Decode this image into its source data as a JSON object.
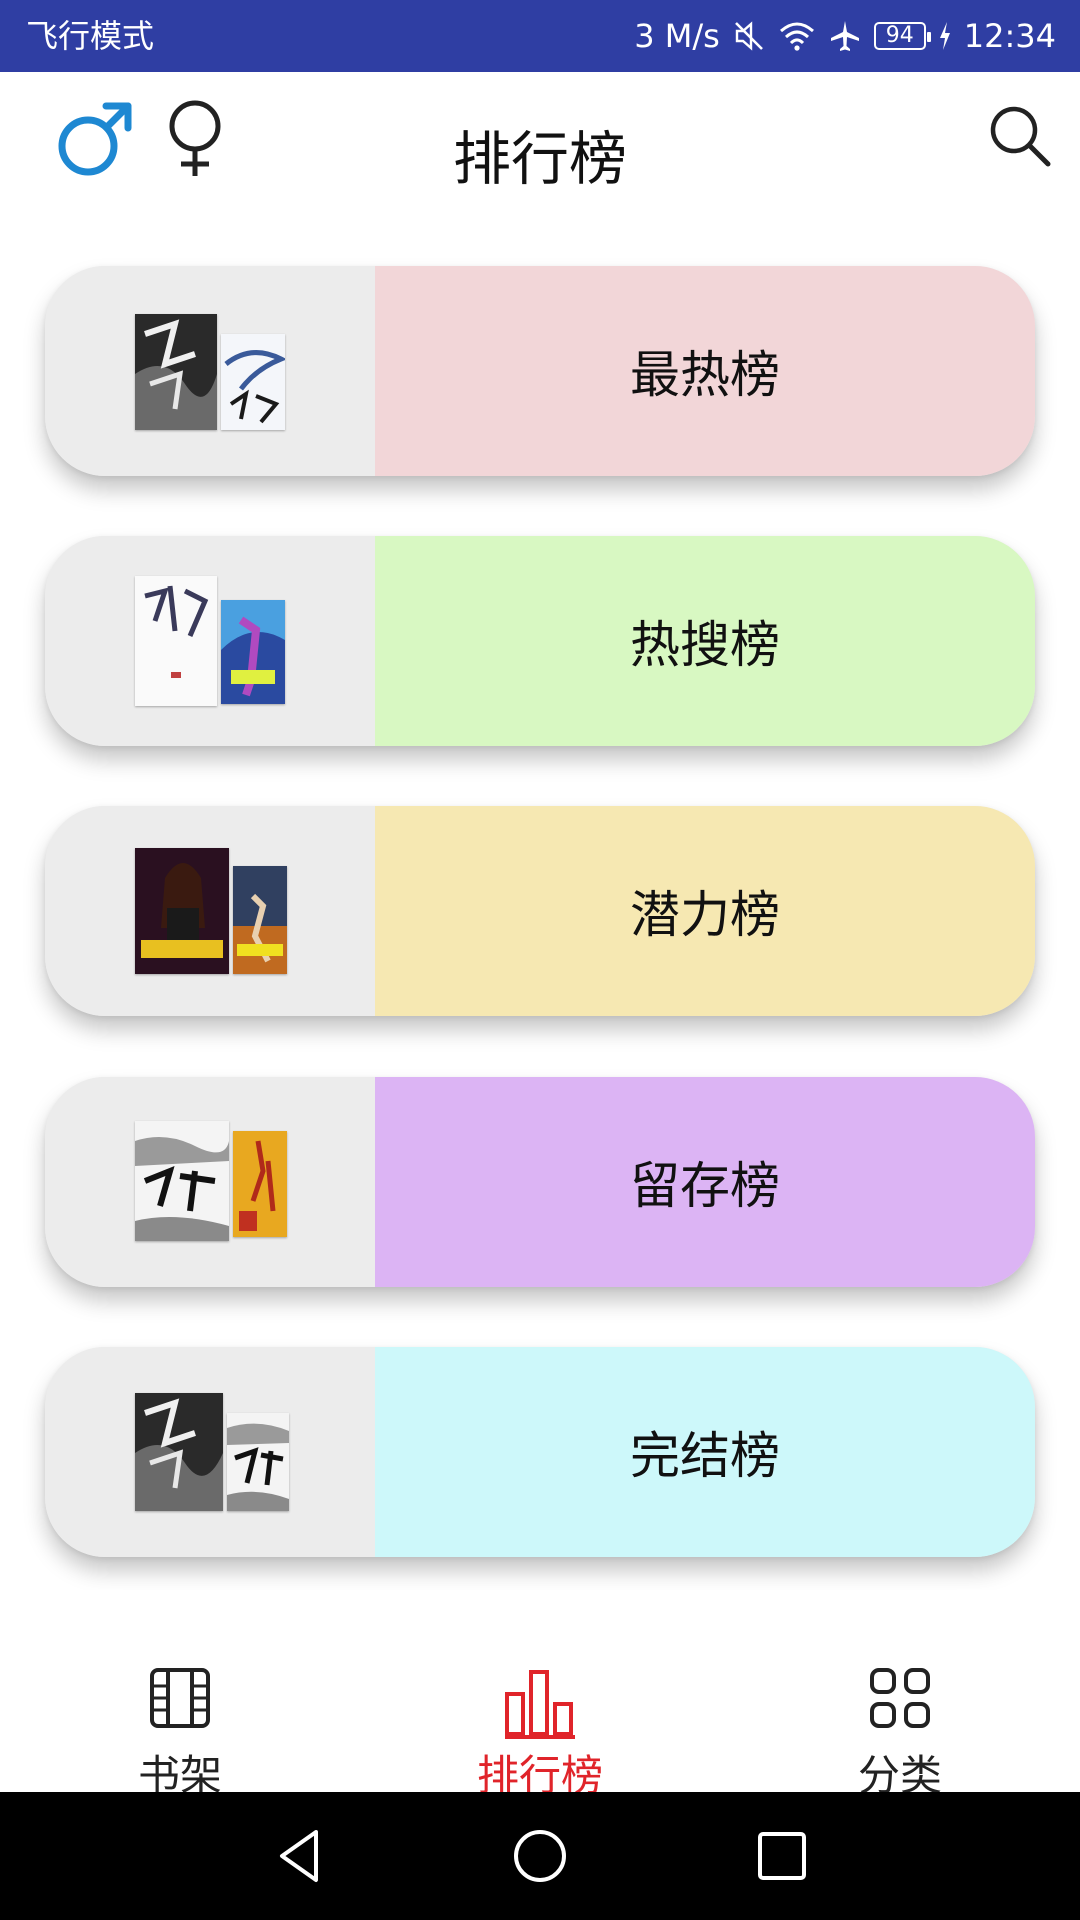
{
  "status_bar": {
    "left_text": "飞行模式",
    "speed": "3 M/s",
    "battery": "94",
    "time": "12:34",
    "icons": [
      "mute-icon",
      "wifi-icon",
      "airplane-icon",
      "battery-icon",
      "charging-icon"
    ]
  },
  "header": {
    "title": "排行榜",
    "male_icon_color": "#1e88d2",
    "icons": [
      "male-icon",
      "female-icon",
      "search-icon"
    ]
  },
  "rankings": [
    {
      "label": "最热榜",
      "color": "#f2d6d8"
    },
    {
      "label": "热搜榜",
      "color": "#d8f8c2"
    },
    {
      "label": "潜力榜",
      "color": "#f6e8b2"
    },
    {
      "label": "留存榜",
      "color": "#dcb4f4"
    },
    {
      "label": "完结榜",
      "color": "#cdf8fa"
    }
  ],
  "bottom_nav": {
    "items": [
      {
        "label": "书架",
        "icon": "bookshelf-icon",
        "active": false
      },
      {
        "label": "排行榜",
        "icon": "ranking-icon",
        "active": true
      },
      {
        "label": "分类",
        "icon": "category-icon",
        "active": false
      }
    ],
    "active_color": "#e0242a",
    "inactive_color": "#222222"
  },
  "system_nav": {
    "icons": [
      "back-icon",
      "home-icon",
      "recents-icon"
    ]
  }
}
